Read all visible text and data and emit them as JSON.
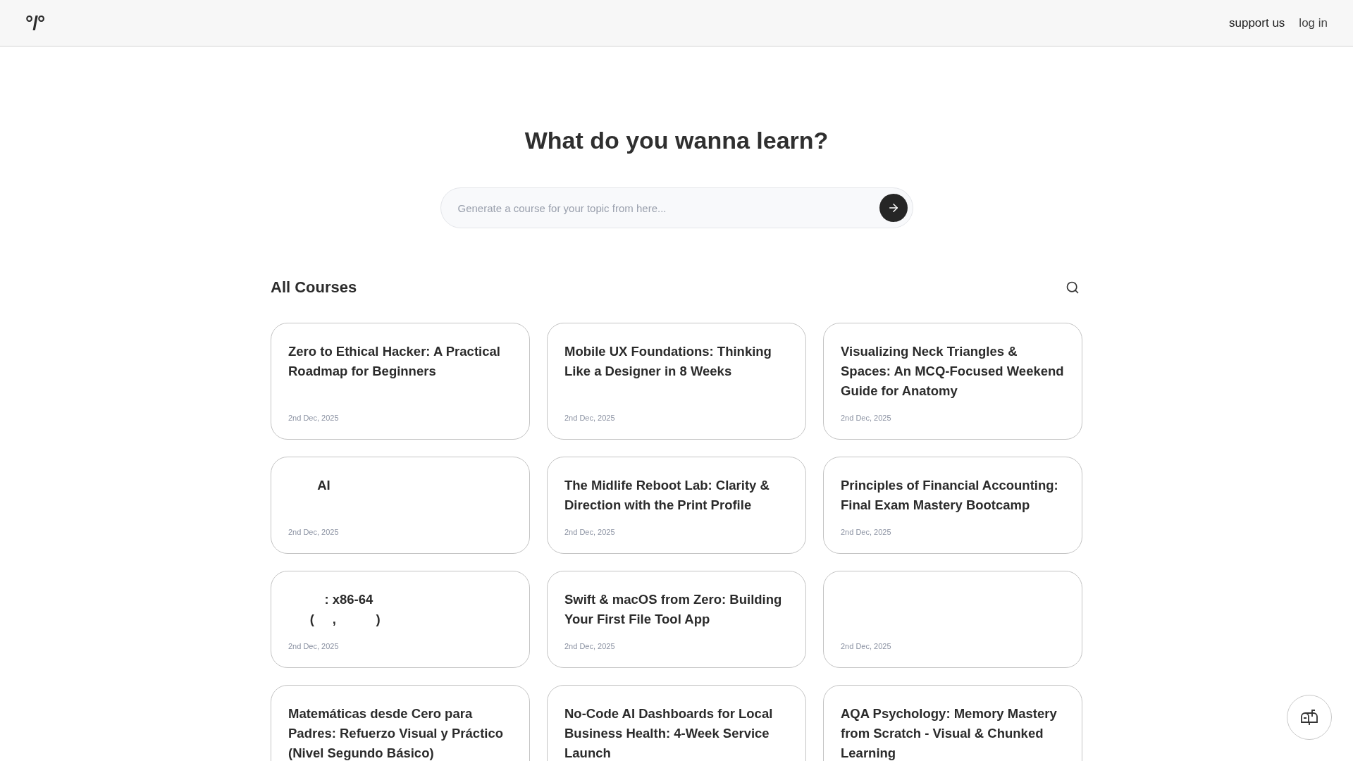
{
  "header": {
    "logo": "°/°",
    "links": [
      {
        "label": "support us",
        "selected": true
      },
      {
        "label": "log in",
        "selected": false
      }
    ]
  },
  "hero": {
    "title": "What do you wanna learn?",
    "search": {
      "placeholder": "Generate a course for your topic from here..."
    }
  },
  "courses": {
    "title": "All Courses",
    "items": [
      {
        "title": "Zero to Ethical Hacker: A Practical Roadmap for Beginners",
        "date": "2nd Dec, 2025"
      },
      {
        "title": "Mobile UX Foundations: Thinking Like a Designer in 8 Weeks",
        "date": "2nd Dec, 2025"
      },
      {
        "title": "Visualizing Neck Triangles & Spaces: An MCQ-Focused Weekend Guide for Anatomy",
        "date": "2nd Dec, 2025"
      },
      {
        "title": "        AI",
        "date": "2nd Dec, 2025"
      },
      {
        "title": "The Midlife Reboot Lab: Clarity & Direction with the Print Profile",
        "date": "2nd Dec, 2025"
      },
      {
        "title": "Principles of Financial Accounting: Final Exam Mastery Bootcamp",
        "date": "2nd Dec, 2025"
      },
      {
        "title": "          : x86-64\n      (     ,           )",
        "date": "2nd Dec, 2025"
      },
      {
        "title": "Swift & macOS from Zero: Building Your First File Tool App",
        "date": "2nd Dec, 2025"
      },
      {
        "date": "2nd Dec, 2025"
      },
      {
        "title": "Matemáticas desde Cero para Padres: Refuerzo Visual y Práctico (Nivel Segundo Básico)"
      },
      {
        "title": "No-Code AI Dashboards for Local Business Health: 4-Week Service Launch"
      },
      {
        "title": "AQA Psychology: Memory Mastery from Scratch - Visual & Chunked Learning"
      }
    ]
  }
}
